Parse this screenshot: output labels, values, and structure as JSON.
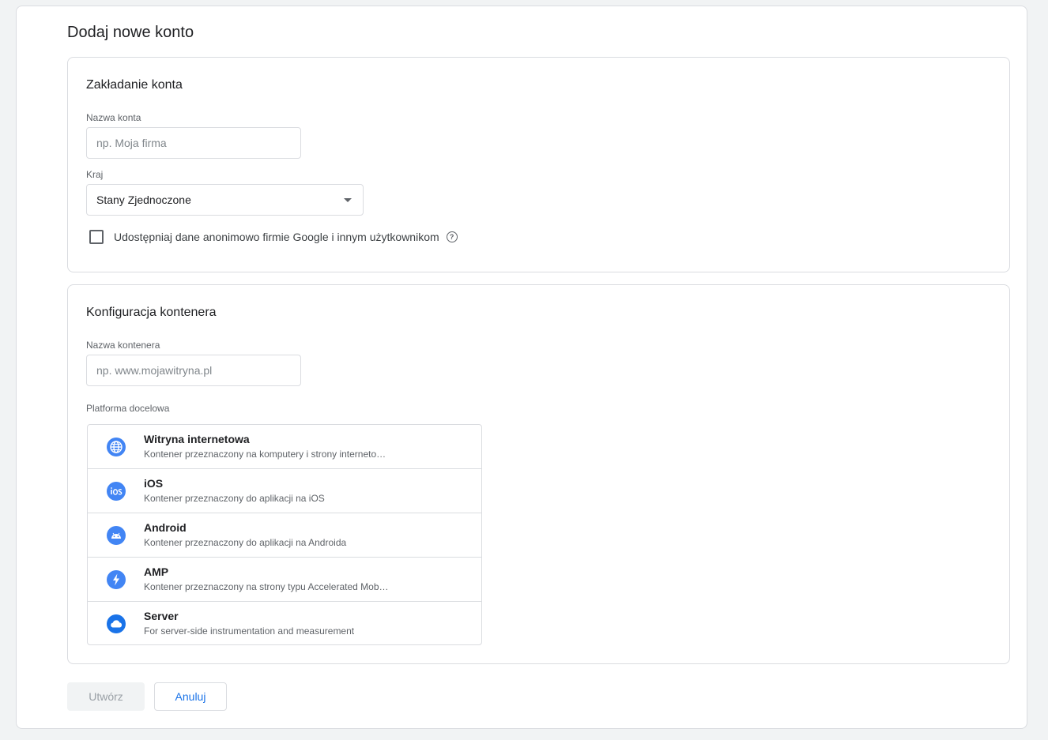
{
  "page": {
    "title": "Dodaj nowe konto"
  },
  "account_setup": {
    "title": "Zakładanie konta",
    "account_name_label": "Nazwa konta",
    "account_name_placeholder": "np. Moja firma",
    "account_name_value": "",
    "country_label": "Kraj",
    "country_value": "Stany Zjednoczone",
    "share_data_label": "Udostępniaj dane anonimowo firmie Google i innym użytkownikom",
    "share_data_checked": false
  },
  "container_setup": {
    "title": "Konfiguracja kontenera",
    "container_name_label": "Nazwa kontenera",
    "container_name_placeholder": "np. www.mojawitryna.pl",
    "container_name_value": "",
    "platform_label": "Platforma docelowa",
    "platforms": [
      {
        "name": "Witryna internetowa",
        "desc": "Kontener przeznaczony na komputery i strony interneto…",
        "icon": "globe-icon"
      },
      {
        "name": "iOS",
        "desc": "Kontener przeznaczony do aplikacji na iOS",
        "icon": "ios-icon"
      },
      {
        "name": "Android",
        "desc": "Kontener przeznaczony do aplikacji na Androida",
        "icon": "android-icon"
      },
      {
        "name": "AMP",
        "desc": "Kontener przeznaczony na strony typu Accelerated Mob…",
        "icon": "amp-icon"
      },
      {
        "name": "Server",
        "desc": "For server-side instrumentation and measurement",
        "icon": "cloud-icon"
      }
    ]
  },
  "actions": {
    "create_label": "Utwórz",
    "cancel_label": "Anuluj"
  },
  "colors": {
    "accent": "#1a73e8",
    "icon_blue": "#4285f4",
    "border": "#dadce0"
  }
}
